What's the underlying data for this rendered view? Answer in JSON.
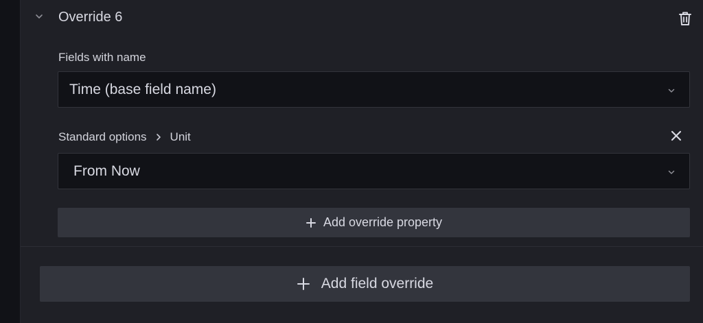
{
  "override": {
    "title": "Override 6",
    "collapse_icon": "chevron-down-icon",
    "delete_icon": "trash-icon"
  },
  "matcher": {
    "label": "Fields with name",
    "value": "Time (base field name)"
  },
  "property": {
    "category": "Standard options",
    "name": "Unit",
    "value": "From Now",
    "remove_icon": "close-icon"
  },
  "buttons": {
    "add_override_property": "Add override property",
    "add_field_override": "Add field override"
  },
  "colors": {
    "background": "#111217",
    "panel": "#1f2026",
    "button": "#33353d",
    "text": "#d8d9e2"
  }
}
